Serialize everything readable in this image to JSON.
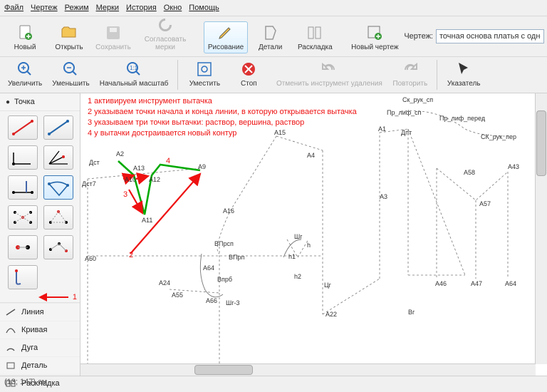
{
  "menu": {
    "items": [
      "Файл",
      "Чертеж",
      "Режим",
      "Мерки",
      "История",
      "Окно",
      "Помощь"
    ]
  },
  "toolbar1": {
    "new": "Новый",
    "open": "Открыть",
    "save": "Сохранить",
    "sync": "Согласовать\nмерки",
    "draw": "Рисование",
    "details": "Детали",
    "layout": "Раскладка",
    "newdraw": "Новый чертеж",
    "label_drawing": "Чертеж:",
    "drawing_value": "точная основа платья с одношовным рукавом"
  },
  "toolbar2": {
    "zoom_in": "Увеличить",
    "zoom_out": "Уменьшить",
    "zoom_init": "Начальный масштаб",
    "fit": "Уместить",
    "stop": "Стоп",
    "undo_del": "Отменить инструмент удаления",
    "redo": "Повторить",
    "pointer": "Указатель"
  },
  "sidebar": {
    "palette_header": "Точка",
    "marker_number": "1",
    "categories": [
      "Линия",
      "Кривая",
      "Дуга",
      "Деталь",
      "Раскладка"
    ]
  },
  "annotations": {
    "lines": [
      "1 активируем инструмент вытачка",
      "2 указываем точки начала и конца линии, в которую открывается вытачка",
      "3 указываем три точки вытачки: раствор, вершина, раствор",
      "4 у вытачки достраивается новый контур"
    ],
    "markers": {
      "n2": "2",
      "n3": "3",
      "n4": "4"
    }
  },
  "points": {
    "Dст7": "Дст7",
    "Dст": "Дст",
    "A2": "А2",
    "A13": "А13",
    "A9": "А9",
    "A10": "А10",
    "A12": "А12",
    "A11": "А11",
    "A60": "А60",
    "A24": "А24",
    "A65": "А55",
    "A66": "А66",
    "Шг3": "Шг-3",
    "ВПрсп": "ВПрсп",
    "ВПрп": "ВПрп",
    "Впрб": "Впрб",
    "A64l": "А64",
    "A16": "А16",
    "A15": "А15",
    "A4": "А4",
    "A1": "А1",
    "Dпт": "Дпт",
    "A3": "А3",
    "h": "h",
    "h1": "h1",
    "h2": "h2",
    "Цг": "Цг",
    "Шг": "Шг",
    "A22": "А22",
    "Вг": "Вг",
    "A46": "А46",
    "A47": "А47",
    "A64r": "А64",
    "Пр_лиф_сп": "Пр_лиф_сп",
    "Ск_рук_сп": "Ск_рук_сп",
    "Пр_лиф_перед": "Пр_лиф_перед",
    "СК_рук_пер": "СК_рук_пер",
    "A58": "А58",
    "A43": "А43",
    "A57": "А57"
  },
  "status": {
    "coords": "(13; 147) см"
  }
}
